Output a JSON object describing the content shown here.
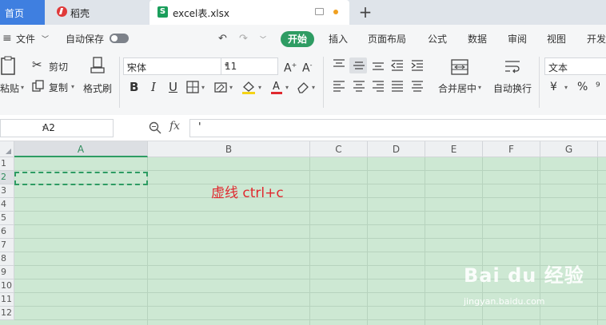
{
  "tabs": {
    "home": "首页",
    "daoke": "稻壳",
    "file": "excel表.xlsx",
    "new_tab": "+"
  },
  "menu": {
    "file": "文件",
    "autosave": "自动保存",
    "items": [
      "开始",
      "插入",
      "页面布局",
      "公式",
      "数据",
      "审阅",
      "视图",
      "开发"
    ]
  },
  "ribbon": {
    "paste": "粘贴",
    "cut": "剪切",
    "copy": "复制",
    "format_painter": "格式刷",
    "font_name": "宋体",
    "font_size": "11",
    "merge_center": "合并居中",
    "wrap_text": "自动换行",
    "number_format": "文本",
    "currency_symbol": "¥",
    "percent_symbol": "%"
  },
  "formula_bar": {
    "name_box": "A2",
    "fx_label": "fx",
    "content": "'"
  },
  "sheet": {
    "columns": [
      "A",
      "B",
      "C",
      "D",
      "E",
      "F",
      "G"
    ],
    "rows": [
      "1",
      "2",
      "3",
      "4",
      "5",
      "6",
      "7",
      "8",
      "9",
      "10",
      "11",
      "12"
    ],
    "annotation": "虚线 ctrl+c"
  },
  "watermark": {
    "brand": "Bai du 经验",
    "url": "jingyan.baidu.com"
  },
  "colors": {
    "accent": "#2e9c63",
    "home_tab": "#3f7fe0",
    "annotation": "#e0282e",
    "sheet_fill": "#cde8d3"
  }
}
